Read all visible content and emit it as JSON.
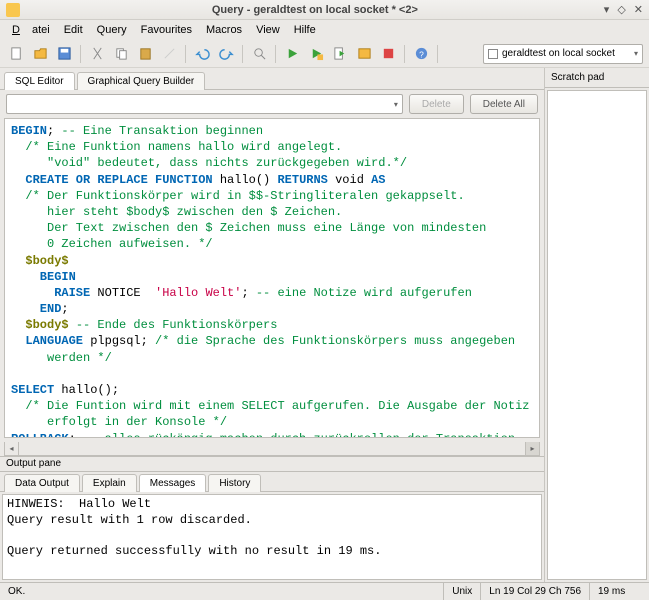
{
  "window": {
    "title": "Query - geraldtest on local socket * <2>"
  },
  "menu": {
    "datei": "Datei",
    "edit": "Edit",
    "query": "Query",
    "favourites": "Favourites",
    "macros": "Macros",
    "view": "View",
    "hilfe": "Hilfe"
  },
  "connection": {
    "label": "geraldtest on local socket"
  },
  "editorTabs": {
    "sql": "SQL Editor",
    "gqb": "Graphical Query Builder"
  },
  "buttons": {
    "delete": "Delete",
    "deleteAll": "Delete All"
  },
  "scratch": {
    "title": "Scratch pad"
  },
  "sql": {
    "l1a": "BEGIN",
    "l1b": "; ",
    "l1c": "-- Eine Transaktion beginnen",
    "l2": "  /* Eine Funktion namens hallo wird angelegt.",
    "l3": "     \"void\" bedeutet, dass nichts zurückgegeben wird.*/",
    "l4a": "  CREATE OR REPLACE FUNCTION ",
    "l4b": "hallo",
    "l4c": "() ",
    "l4d": "RETURNS",
    "l4e": " void ",
    "l4f": "AS",
    "l5": "  /* Der Funktionskörper wird in $$-Stringliteralen gekappselt.",
    "l6": "     hier steht $body$ zwischen den $ Zeichen.",
    "l7": "     Der Text zwischen den $ Zeichen muss eine Länge von mindesten",
    "l8": "     0 Zeichen aufweisen. */",
    "l9": "  $body$",
    "l10": "    BEGIN",
    "l11a": "      RAISE",
    "l11b": " NOTICE  ",
    "l11c": "'Hallo Welt'",
    "l11d": "; ",
    "l11e": "-- eine Notize wird aufgerufen",
    "l12": "    END",
    "l12b": ";",
    "l13": "  $body$ ",
    "l13b": "-- Ende des Funktionskörpers",
    "l14a": "  LANGUAGE ",
    "l14b": "plpgsql; ",
    "l14c": "/* die Sprache des Funktionskörpers muss angegeben",
    "l15": "     werden */",
    "l16": "",
    "l17a": "SELECT ",
    "l17b": "hallo",
    "l17c": "();",
    "l18": "  /* Die Funtion wird mit einem SELECT aufgerufen. Die Ausgabe der Notiz",
    "l19": "     erfolgt in der Konsole */",
    "l20a": "ROLLBACK",
    "l20b": "; ",
    "l20c": "-- alles rückängig machen durch zurückrollen der Transaktion."
  },
  "outputHeader": "Output pane",
  "outputTabs": {
    "data": "Data Output",
    "explain": "Explain",
    "messages": "Messages",
    "history": "History"
  },
  "messages": {
    "l1": "HINWEIS:  Hallo Welt",
    "l2": "Query result with 1 row discarded.",
    "l3": "",
    "l4": "Query returned successfully with no result in 19 ms."
  },
  "status": {
    "ok": "OK.",
    "enc": "Unix",
    "pos": "Ln 19 Col 29 Ch 756",
    "time": "19 ms"
  }
}
